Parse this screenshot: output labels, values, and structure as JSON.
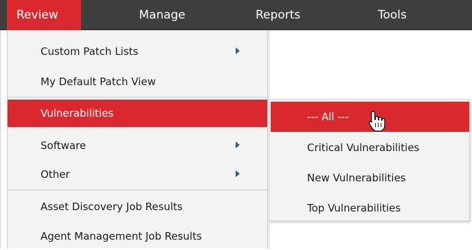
{
  "menubar": {
    "items": [
      {
        "label": "Review"
      },
      {
        "label": "Manage"
      },
      {
        "label": "Reports"
      },
      {
        "label": "Tools"
      }
    ],
    "active": "Review"
  },
  "review_menu": {
    "items": [
      {
        "label": "Custom Patch Lists",
        "has_submenu": true
      },
      {
        "label": "My Default Patch View",
        "has_submenu": false
      },
      {
        "label": "Vulnerabilities",
        "has_submenu": true,
        "selected": true
      },
      {
        "label": "Software",
        "has_submenu": true
      },
      {
        "label": "Other",
        "has_submenu": true
      },
      {
        "label": "Asset Discovery Job Results",
        "has_submenu": false
      },
      {
        "label": "Agent Management Job Results",
        "has_submenu": false
      }
    ]
  },
  "vulnerabilities_submenu": {
    "items": [
      {
        "label": "--- All ---",
        "selected": true
      },
      {
        "label": "Critical Vulnerabilities"
      },
      {
        "label": "New Vulnerabilities"
      },
      {
        "label": "Top Vulnerabilities"
      }
    ]
  },
  "colors": {
    "menubar_bg": "#3e3e3e",
    "accent": "#d9282e",
    "menu_bg": "#f3f3f3",
    "submenu_arrow": "#2f5f8f"
  },
  "icons": {
    "cursor": "hand-pointer-icon",
    "submenu_arrow": "chevron-right-icon"
  }
}
